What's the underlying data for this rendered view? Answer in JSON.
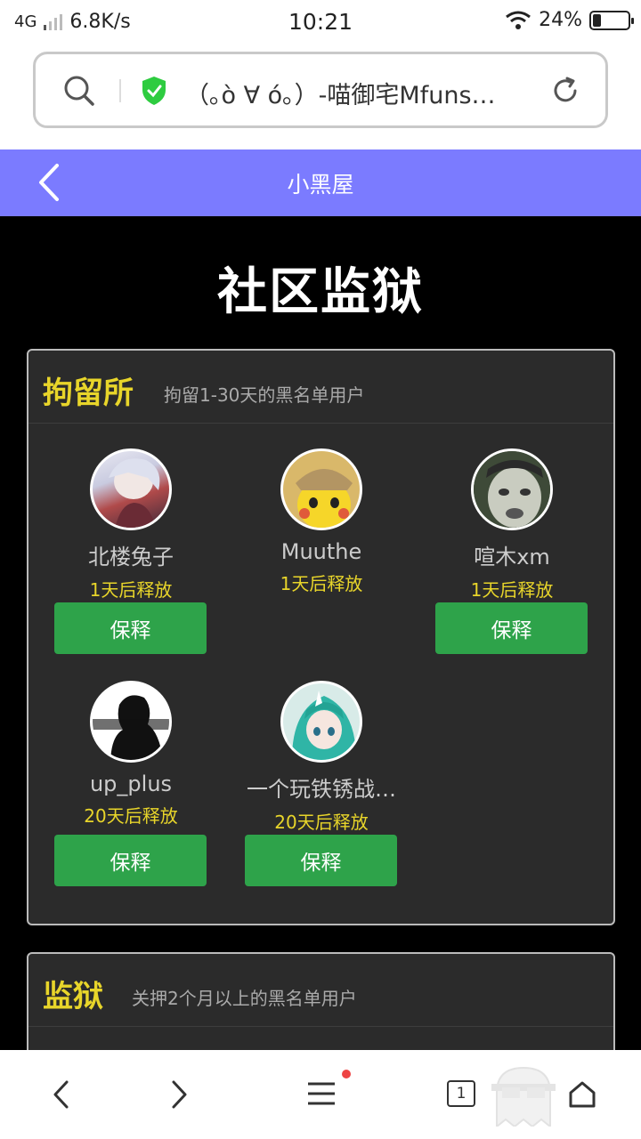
{
  "status": {
    "network": "4G",
    "speed": "6.8K/s",
    "time": "10:21",
    "battery": "24%",
    "battery_level": 0.24
  },
  "browser": {
    "page_title": "（｡ò ∀ ó｡）-喵御宅Mfuns…",
    "tab_count": "1"
  },
  "header": {
    "title": "小黑屋"
  },
  "page": {
    "title": "社区监狱"
  },
  "detention": {
    "title": "拘留所",
    "subtitle": "拘留1-30天的黑名单用户",
    "bail_label": "保释",
    "users": [
      {
        "name": "北楼兔子",
        "release": "1天后释放"
      },
      {
        "name": "Muuthe",
        "release": "1天后释放"
      },
      {
        "name": "喧木xm",
        "release": "1天后释放"
      },
      {
        "name": "up_plus",
        "release": "20天后释放"
      },
      {
        "name": "一个玩铁锈战…",
        "release": "20天后释放"
      }
    ]
  },
  "prison": {
    "title": "监狱",
    "subtitle": "关押2个月以上的黑名单用户"
  },
  "colors": {
    "header_bg": "#7b7bff",
    "accent_yellow": "#e8d52a",
    "button_green": "#2ea34a",
    "card_bg": "#2b2b2b"
  }
}
